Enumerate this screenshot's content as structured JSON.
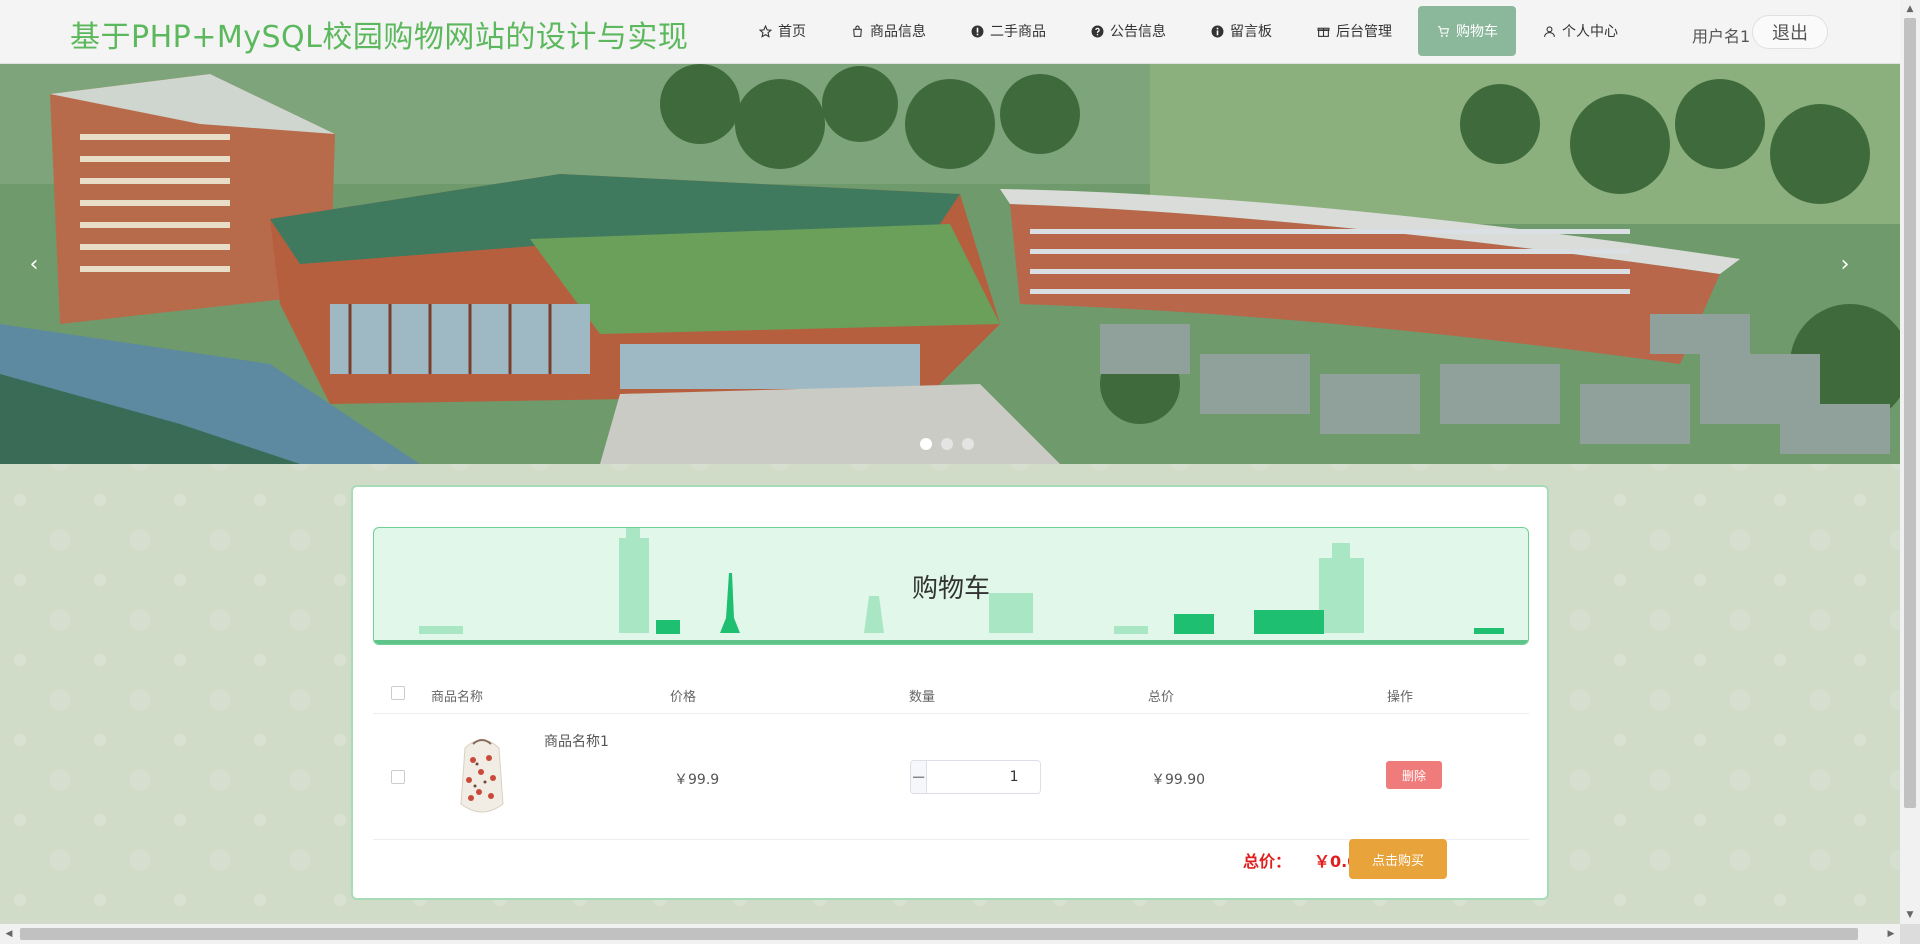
{
  "header": {
    "site_title": "基于PHP+MySQL校园购物网站的设计与实现",
    "nav": [
      {
        "label": "首页",
        "icon": "star-icon"
      },
      {
        "label": "商品信息",
        "icon": "bag-icon"
      },
      {
        "label": "二手商品",
        "icon": "info-icon"
      },
      {
        "label": "公告信息",
        "icon": "question-icon"
      },
      {
        "label": "留言板",
        "icon": "info-icon"
      },
      {
        "label": "后台管理",
        "icon": "gift-icon"
      },
      {
        "label": "购物车",
        "icon": "cart-icon",
        "active": true
      },
      {
        "label": "个人中心",
        "icon": "user-icon"
      }
    ],
    "user_name": "用户名1",
    "logout_label": "退出"
  },
  "banner": {
    "prev_glyph": "‹",
    "next_glyph": "›",
    "slide_count": 3,
    "active_slide": 1
  },
  "cart": {
    "title": "购物车",
    "columns": {
      "name": "商品名称",
      "price": "价格",
      "quantity": "数量",
      "subtotal": "总价",
      "action": "操作"
    },
    "items": [
      {
        "name": "商品名称1",
        "price": "￥99.9",
        "quantity": "1",
        "subtotal": "￥99.90",
        "delete_label": "删除"
      }
    ],
    "total_label": "总价：",
    "total_value": "￥0.00",
    "buy_label": "点击购买",
    "minus_glyph": "−",
    "plus_glyph": "+"
  },
  "colors": {
    "brand_green": "#5cb85c",
    "nav_active": "#8bb89b",
    "delete_red": "#f07b7b",
    "buy_orange": "#e8a33a",
    "total_red": "#e02020"
  }
}
